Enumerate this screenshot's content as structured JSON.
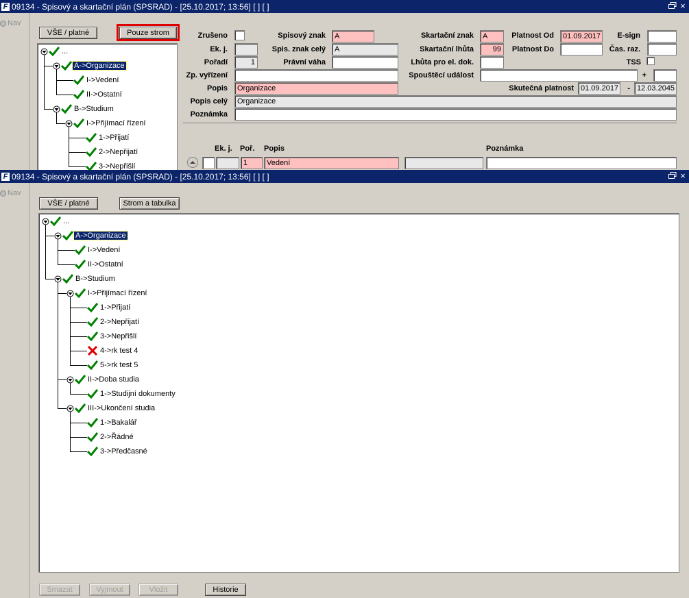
{
  "window_title": "09134 - Spisový a skartační plán (SPSRAD) - [25.10.2017; 13:56]  [ ]  [ ]",
  "nav_label": "Nav",
  "win1": {
    "buttons": {
      "all_valid": "VŠE / platné",
      "tree_only": "Pouze strom"
    },
    "tree": [
      {
        "label": "...",
        "mark": "check",
        "selected": false
      },
      {
        "label": "A->Organizace",
        "mark": "check",
        "selected": true
      },
      {
        "label": "I->Vedení",
        "mark": "check",
        "selected": false
      },
      {
        "label": "II->Ostatní",
        "mark": "check",
        "selected": false
      },
      {
        "label": "B->Studium",
        "mark": "check",
        "selected": false
      },
      {
        "label": "I->Přijímací řízení",
        "mark": "check",
        "selected": false
      },
      {
        "label": "1->Přijatí",
        "mark": "check",
        "selected": false
      },
      {
        "label": "2->Nepřijatí",
        "mark": "check",
        "selected": false
      },
      {
        "label": "3->Nepřišlí",
        "mark": "check",
        "selected": false
      }
    ],
    "form": {
      "labels": {
        "zruseno": "Zrušeno",
        "ek_j": "Ek. j.",
        "poradi": "Pořadí",
        "zp_vyrizeni": "Zp. vyřízení",
        "popis": "Popis",
        "popis_cely": "Popis celý",
        "poznamka": "Poznámka",
        "spisovy_znak": "Spisový znak",
        "spis_znak_cely": "Spis. znak celý",
        "pravni_vaha": "Právní váha",
        "skartacni_znak": "Skartační znak",
        "skartacni_lhuta": "Skartační lhůta",
        "lhuta_el_dok": "Lhůta pro el. dok.",
        "spousteci_udalost": "Spouštěcí událost",
        "skutecna_platnost": "Skutečná platnost",
        "platnost_od": "Platnost Od",
        "platnost_do": "Platnost Do",
        "e_sign": "E-sign",
        "cas_raz": "Čas. raz.",
        "tss": "TSS",
        "plus": "+",
        "dash": "-"
      },
      "values": {
        "poradi": "1",
        "spisovy_znak": "A",
        "spis_znak_cely": "A",
        "skartacni_znak": "A",
        "skartacni_lhuta": "99",
        "platnost_od": "01.09.2017",
        "popis": "Organizace",
        "popis_cely": "Organizace",
        "skutecna_od": "01.09.2017",
        "skutecna_do": "12.03.2045"
      }
    },
    "table": {
      "headers": {
        "ek_j": "Ek. j.",
        "por": "Poř.",
        "popis": "Popis",
        "poznamka": "Poznámka"
      },
      "rows": [
        {
          "por": "1",
          "popis": "Vedení",
          "poznamka": ""
        }
      ]
    }
  },
  "win2": {
    "buttons": {
      "all_valid": "VŠE / platné",
      "tree_table": "Strom a tabulka"
    },
    "tree": [
      {
        "label": "...",
        "mark": "check",
        "selected": false
      },
      {
        "label": "A->Organizace",
        "mark": "check",
        "selected": true
      },
      {
        "label": "I->Vedení",
        "mark": "check",
        "selected": false
      },
      {
        "label": "II->Ostatní",
        "mark": "check",
        "selected": false
      },
      {
        "label": "B->Studium",
        "mark": "check",
        "selected": false
      },
      {
        "label": "I->Přijímací řízení",
        "mark": "check",
        "selected": false
      },
      {
        "label": "1->Přijatí",
        "mark": "check",
        "selected": false
      },
      {
        "label": "2->Nepřijatí",
        "mark": "check",
        "selected": false
      },
      {
        "label": "3->Nepřišlí",
        "mark": "check",
        "selected": false
      },
      {
        "label": "4->rk test 4",
        "mark": "cross",
        "selected": false
      },
      {
        "label": "5->rk test 5",
        "mark": "check",
        "selected": false
      },
      {
        "label": "II->Doba studia",
        "mark": "check",
        "selected": false
      },
      {
        "label": "1->Studijní dokumenty",
        "mark": "check",
        "selected": false
      },
      {
        "label": "III->Ukončení studia",
        "mark": "check",
        "selected": false
      },
      {
        "label": "1->Bakalář",
        "mark": "check",
        "selected": false
      },
      {
        "label": "2->Řádné",
        "mark": "check",
        "selected": false
      },
      {
        "label": "3->Předčasné",
        "mark": "check",
        "selected": false
      }
    ],
    "bottom_buttons": {
      "delete": "Smazat",
      "cut": "Vyjmout",
      "paste": "Vložit",
      "history": "Historie"
    }
  },
  "colors": {
    "title_bar": "#0b246a",
    "required_field": "#ffc0c0",
    "check": "#008000",
    "cross": "#e00000"
  }
}
